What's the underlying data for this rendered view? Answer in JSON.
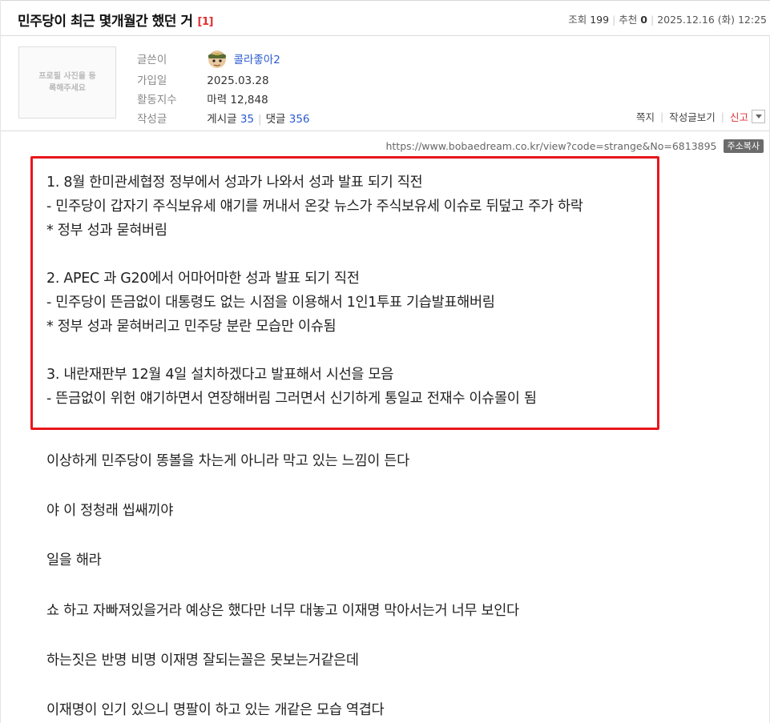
{
  "post": {
    "title": "민주당이 최근 몇개월간 했던 거",
    "comment_count": "[1]",
    "views_label": "조회",
    "views": "199",
    "recommend_label": "추천",
    "recommend": "0",
    "date": "2025.12.16 (화) 12:25"
  },
  "profile": {
    "photo_placeholder": "프로필 사진을 등록해주세요",
    "author_label": "글쓴이",
    "author": "콜라좋아2",
    "joined_label": "가입일",
    "joined": "2025.03.28",
    "activity_label": "활동지수",
    "activity": "마력 12,848",
    "posts_label": "작성글",
    "posts_text": "게시글",
    "posts_count": "35",
    "comments_text": "댓글",
    "comments_count": "356"
  },
  "actions": {
    "message": "쪽지",
    "view_posts": "작성글보기",
    "report": "신고"
  },
  "url": {
    "text": "https://www.bobaedream.co.kr/view?code=strange&No=6813895",
    "copy_label": "주소복사"
  },
  "boxed_lines": [
    "1. 8월 한미관세협정 정부에서 성과가 나와서 성과 발표 되기 직전",
    "- 민주당이 갑자기 주식보유세 얘기를 꺼내서 온갖 뉴스가 주식보유세 이슈로 뒤덮고 주가 하락",
    "* 정부 성과 묻혀버림",
    "",
    "2. APEC 과 G20에서 어마어마한 성과 발표 되기 직전",
    "- 민주당이 뜬금없이 대통령도 없는 시점을 이용해서 1인1투표 기습발표해버림",
    "* 정부 성과 묻혀버리고 민주당 분란 모습만 이슈됨",
    "",
    "3. 내란재판부 12월 4일 설치하겠다고 발표해서 시선을 모음",
    "- 뜬금없이 위헌 얘기하면서 연장해버림 그러면서 신기하게 통일교 전재수 이슈몰이 됨"
  ],
  "paragraphs": [
    "이상하게 민주당이 똥볼을 차는게 아니라 막고 있는 느낌이 든다",
    "야 이 정청래 씹쌔끼야",
    "일을 해라",
    "쇼 하고 자빠져있을거라 예상은 했다만 너무 대놓고 이재명 막아서는거 너무 보인다",
    "하는짓은 반명 비명 이재명 잘되는꼴은 못보는거같은데",
    "이재명이 인기 있으니 명팔이 하고 있는 개같은 모습 역겹다"
  ]
}
